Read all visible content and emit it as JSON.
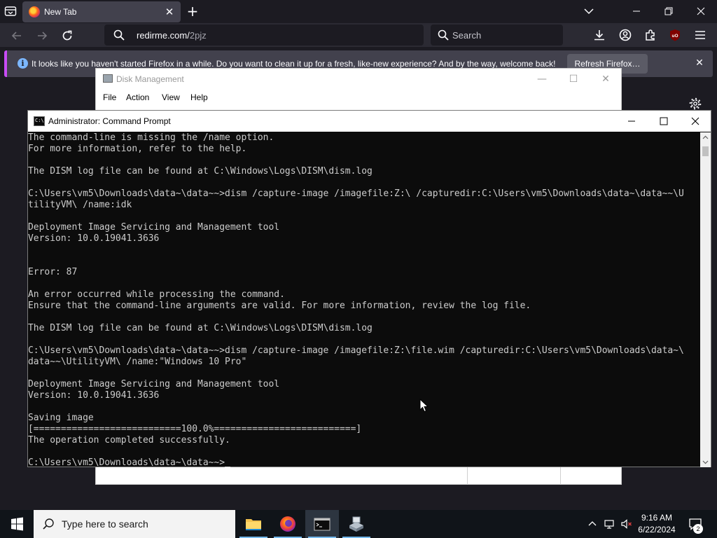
{
  "browser": {
    "tab_title": "New Tab",
    "url_host": "redirme.com/",
    "url_path": "2pjz",
    "search_placeholder": "Search",
    "notification_text": "It looks like you haven't started Firefox in a while. Do you want to clean it up for a fresh, like-new experience? And by the way, welcome back!",
    "notification_button": "Refresh Firefox…",
    "icons": [
      "tabs-list-icon",
      "firefox-icon",
      "close-icon",
      "plus-icon",
      "chevron-down-icon",
      "back-icon",
      "forward-icon",
      "reload-icon",
      "search-icon",
      "download-icon",
      "account-icon",
      "extensions-icon",
      "ublock-icon",
      "menu-icon",
      "info-icon",
      "gear-icon"
    ]
  },
  "disk_management": {
    "title": "Disk Management",
    "menus": [
      "File",
      "Action",
      "View",
      "Help"
    ]
  },
  "cmd": {
    "title": "Administrator: Command Prompt",
    "lines": [
      "The command-line is missing the /name option.",
      "For more information, refer to the help.",
      "",
      "The DISM log file can be found at C:\\Windows\\Logs\\DISM\\dism.log",
      "",
      "C:\\Users\\vm5\\Downloads\\data~\\data~~>dism /capture-image /imagefile:Z:\\ /capturedir:C:\\Users\\vm5\\Downloads\\data~\\data~~\\U",
      "tilityVM\\ /name:idk",
      "",
      "Deployment Image Servicing and Management tool",
      "Version: 10.0.19041.3636",
      "",
      "",
      "Error: 87",
      "",
      "An error occurred while processing the command.",
      "Ensure that the command-line arguments are valid. For more information, review the log file.",
      "",
      "The DISM log file can be found at C:\\Windows\\Logs\\DISM\\dism.log",
      "",
      "C:\\Users\\vm5\\Downloads\\data~\\data~~>dism /capture-image /imagefile:Z:\\file.wim /capturedir:C:\\Users\\vm5\\Downloads\\data~\\",
      "data~~\\UtilityVM\\ /name:\"Windows 10 Pro\"",
      "",
      "Deployment Image Servicing and Management tool",
      "Version: 10.0.19041.3636",
      "",
      "Saving image",
      "[===========================100.0%==========================]",
      "The operation completed successfully.",
      "",
      "C:\\Users\\vm5\\Downloads\\data~\\data~~>"
    ]
  },
  "taskbar": {
    "search_placeholder": "Type here to search",
    "time": "9:16 AM",
    "date": "6/22/2024",
    "notification_count": "2",
    "apps": [
      "file-explorer-icon",
      "firefox-icon",
      "command-prompt-icon",
      "disk-management-icon"
    ]
  },
  "colors": {
    "firefox_bg": "#1c1b22",
    "notification_accent": "#c84cf5",
    "cmd_bg": "#0c0c0c",
    "cmd_text": "#cccccc",
    "taskbar_bg": "#101419"
  }
}
